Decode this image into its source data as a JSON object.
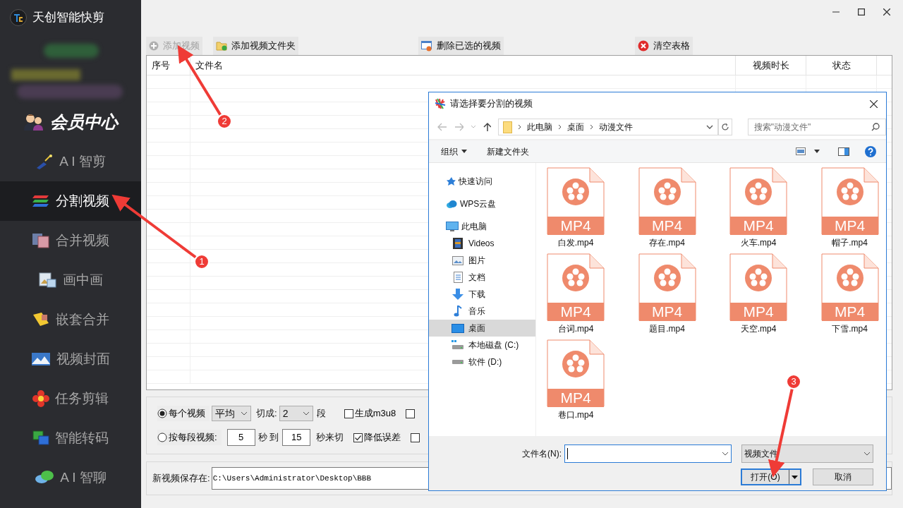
{
  "app": {
    "title": "天创智能快剪"
  },
  "sidebar": {
    "items": [
      {
        "label": "会员中心",
        "kind": "member",
        "selected": false
      },
      {
        "label": "A I 智剪",
        "kind": "nav",
        "selected": false
      },
      {
        "label": "分割视频",
        "kind": "nav",
        "selected": true
      },
      {
        "label": "合并视频",
        "kind": "nav",
        "selected": false
      },
      {
        "label": "画中画",
        "kind": "nav",
        "selected": false
      },
      {
        "label": "嵌套合并",
        "kind": "nav",
        "selected": false
      },
      {
        "label": "视频封面",
        "kind": "nav",
        "selected": false
      },
      {
        "label": "任务剪辑",
        "kind": "nav",
        "selected": false
      },
      {
        "label": "智能转码",
        "kind": "nav",
        "selected": false
      },
      {
        "label": "A I 智聊",
        "kind": "nav",
        "selected": false
      }
    ]
  },
  "toolbar": [
    {
      "label": "添加视频",
      "disabled": true
    },
    {
      "label": "添加视频文件夹",
      "disabled": false
    },
    {
      "label": "删除已选的视频",
      "disabled": false
    },
    {
      "label": "清空表格",
      "disabled": false
    }
  ],
  "table": {
    "columns": [
      "序号",
      "文件名",
      "视频时长",
      "状态"
    ]
  },
  "options": {
    "row1": {
      "radio": {
        "label": "每个视频",
        "selected": true
      },
      "mode": "平均",
      "cut_label": "切成:",
      "count": "2",
      "unit": "段",
      "checks": [
        {
          "label": "生成m3u8",
          "checked": false
        },
        {
          "checked": false
        }
      ]
    },
    "row2": {
      "radio": {
        "label": "按每段视频:",
        "selected": false
      },
      "from": "5",
      "mid": "秒 到",
      "to": "15",
      "suffix": "秒来切",
      "checks": [
        {
          "label": "降低误差",
          "checked": true
        },
        {
          "checked": false
        }
      ]
    }
  },
  "save": {
    "label": "新视频保存在:",
    "value": "C:\\Users\\Administrator\\Desktop\\BBB"
  },
  "dialog": {
    "title": "请选择要分割的视频",
    "path": [
      "此电脑",
      "桌面",
      "动漫文件"
    ],
    "search": {
      "placeholder": "搜索\"动漫文件\""
    },
    "commands": [
      "组织",
      "新建文件夹"
    ],
    "nav": [
      {
        "label": "快速访问",
        "selected": false
      },
      {
        "label": "WPS云盘",
        "selected": false
      },
      {
        "label": "此电脑",
        "selected": false,
        "children": [
          {
            "label": "Videos",
            "selected": false
          },
          {
            "label": "图片",
            "selected": false
          },
          {
            "label": "文档",
            "selected": false
          },
          {
            "label": "下载",
            "selected": false
          },
          {
            "label": "音乐",
            "selected": false
          },
          {
            "label": "桌面",
            "selected": true
          },
          {
            "label": "本地磁盘 (C:)",
            "selected": false
          },
          {
            "label": "软件 (D:)",
            "selected": false
          }
        ]
      }
    ],
    "files": [
      {
        "name": "白发.mp4",
        "badge": "MP4"
      },
      {
        "name": "存在.mp4",
        "badge": "MP4"
      },
      {
        "name": "火车.mp4",
        "badge": "MP4"
      },
      {
        "name": "帽子.mp4",
        "badge": "MP4"
      },
      {
        "name": "台词.mp4",
        "badge": "MP4"
      },
      {
        "name": "题目.mp4",
        "badge": "MP4"
      },
      {
        "name": "天空.mp4",
        "badge": "MP4"
      },
      {
        "name": "下雪.mp4",
        "badge": "MP4"
      },
      {
        "name": "巷口.mp4",
        "badge": "MP4"
      }
    ],
    "filename_label": "文件名(N):",
    "filetype": "视频文件",
    "open_button": "打开(O)",
    "cancel_button": "取消"
  },
  "callouts": [
    "1",
    "2",
    "3"
  ]
}
